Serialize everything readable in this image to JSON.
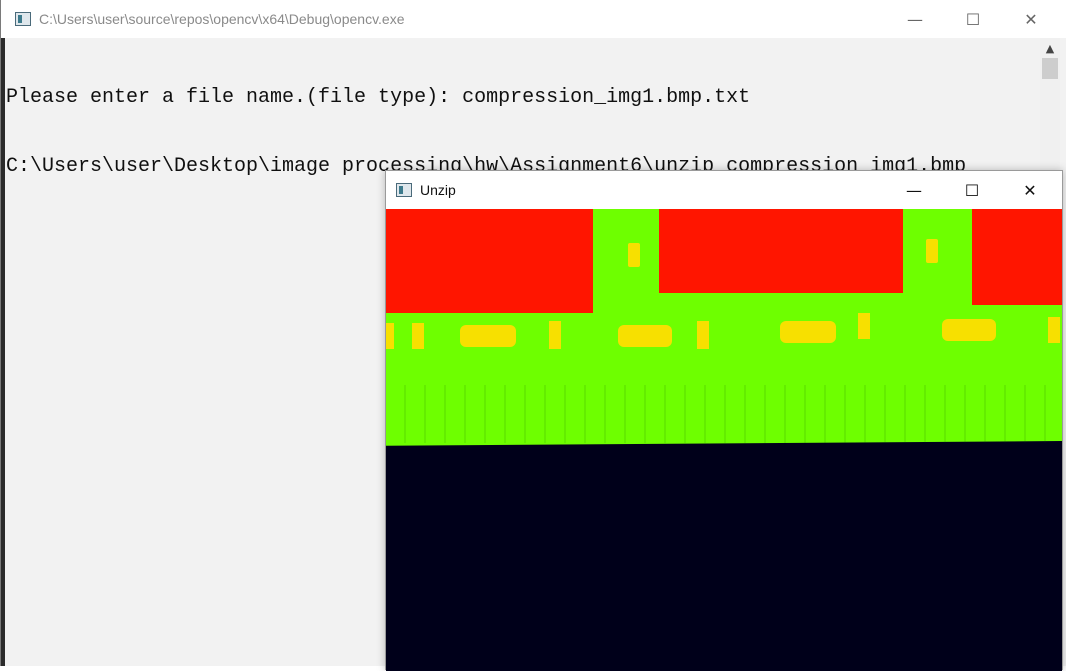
{
  "console": {
    "title": "C:\\Users\\user\\source\\repos\\opencv\\x64\\Debug\\opencv.exe",
    "lines": [
      "Please enter a file name.(file type): compression_img1.bmp.txt",
      "C:\\Users\\user\\Desktop\\image processing\\hw\\Assignment6\\unzip_compression_img1.bmp"
    ],
    "icons": {
      "minimize": "minimize-icon",
      "maximize": "maximize-icon",
      "close": "close-icon",
      "scroll_up": "chevron-up-icon"
    }
  },
  "unzip_window": {
    "title": "Unzip",
    "image_colors": {
      "red": "#ff1500",
      "green": "#6eff00",
      "yellow": "#f7e000",
      "dark": "#00001a"
    }
  }
}
